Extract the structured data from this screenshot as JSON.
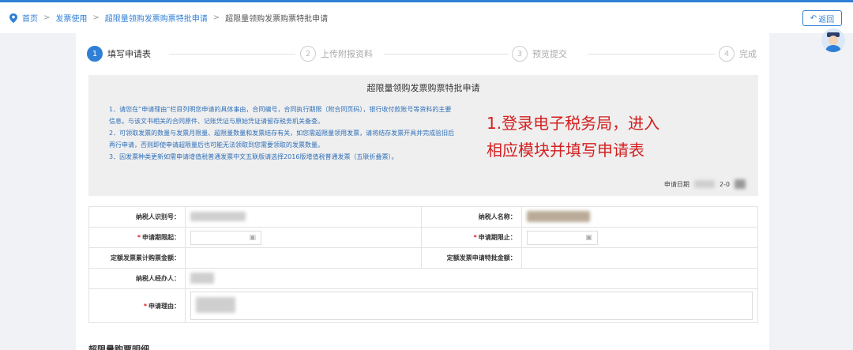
{
  "breadcrumb": {
    "items": [
      "首页",
      "发票使用",
      "超限量领购发票购票特批申请",
      "超限量领购发票购票特批申请"
    ]
  },
  "header": {
    "back_label": "返回"
  },
  "steps": [
    {
      "num": "1",
      "label": "填写申请表"
    },
    {
      "num": "2",
      "label": "上传附报资料"
    },
    {
      "num": "3",
      "label": "预览提交"
    },
    {
      "num": "4",
      "label": "完成"
    }
  ],
  "notice": {
    "title": "超限量领购发票购票特批申请",
    "lines": [
      "1．请您在“申请理由”栏目列明您申请的具体事由，合同编号，合同执行期限（附合同页码），银行收付款账号等资料的主要信息。与该文书相关的合同原件、记账凭证与原始凭证请留存税务机关备查。",
      "2．可领取发票的数量与发票月限量、超限量数量和发票结存有关，如您需超限量领用发票，请将结存发票开具并完成验旧后再行申请，否则即使申请超限量后也可能无法领取到您需要领取的发票数量。",
      "3．因发票种类更新如需申请增值税普通发票中文五联版请选择2016版增值税普通发票（五联折叠票）。"
    ],
    "overlay_line1": "1.登录电子税务局，进入",
    "overlay_line2": "相应模块并填写申请表",
    "date_label": "申请日期",
    "date_value_partial": "2-0"
  },
  "form": {
    "taxpayer_id_label": "纳税人识别号：",
    "taxpayer_name_label": "纳税人名称：",
    "period_start_label": "申请期限起：",
    "period_end_label": "申请期限止：",
    "quota_total_label": "定额发票累计购票金额：",
    "quota_approved_label": "定额发票申请特批金额：",
    "handler_label": "纳税人经办人：",
    "reason_label": "申请理由："
  },
  "section_below": {
    "title": "超限量购票明细"
  },
  "colors": {
    "accent": "#2f7fd6",
    "overlay_red": "#d42020",
    "required": "#e02020"
  }
}
